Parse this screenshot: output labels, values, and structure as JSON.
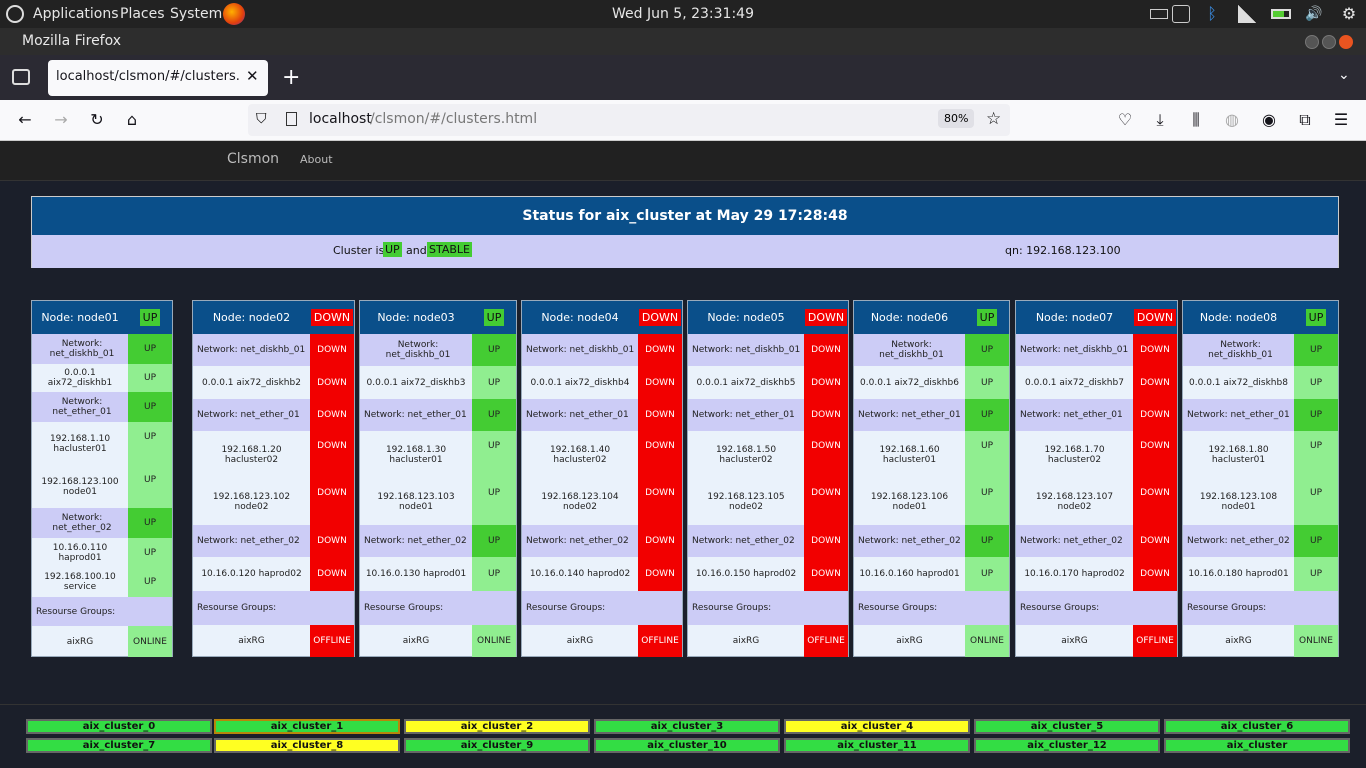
{
  "system_bar": {
    "applications": "Applications",
    "places": "Places",
    "system": "System",
    "clock": "Wed Jun  5, 23:31:49"
  },
  "browser": {
    "window_title": "Mozilla Firefox",
    "tab_title": "localhost/clsmon/#/clusters.html",
    "url_host": "localhost",
    "url_path": "/clsmon/#/clusters.html",
    "zoom": "80%"
  },
  "app": {
    "brand": "Clsmon",
    "about": "About"
  },
  "status": {
    "title": "Status for aix_cluster at May 29 17:28:48",
    "cluster_is": "Cluster is",
    "state": "UP",
    "and": "and",
    "stability": "STABLE",
    "qn": "qn: 192.168.123.100"
  },
  "nodes": [
    {
      "name": "Node: node01",
      "state": "UP",
      "net1": "Network: net_diskhb_01",
      "net1_state": "UP",
      "if1": "0.0.0.1 aix72_diskhb1",
      "if1_state": "UP",
      "net2": "Network: net_ether_01",
      "net2_state": "UP",
      "ip1": "192.168.1.10",
      "ip1_host": "hacluster01",
      "ip1_state": "UP",
      "ip2": "192.168.123.100",
      "ip2_host": "node01",
      "ip2_state": "UP",
      "net3": "Network: net_ether_02",
      "net3_state": "UP",
      "if2": "10.16.0.110 haprod01",
      "if2_state": "UP",
      "if3": "192.168.100.10 service",
      "if3_state": "UP",
      "rg_label": "Resourse Groups:",
      "rg": "aixRG",
      "rg_state": "ONLINE"
    },
    {
      "name": "Node: node02",
      "state": "DOWN",
      "net1": "Network: net_diskhb_01",
      "net1_state": "DOWN",
      "if1": "0.0.0.1 aix72_diskhb2",
      "if1_state": "DOWN",
      "net2": "Network: net_ether_01",
      "net2_state": "DOWN",
      "ip1": "192.168.1.20",
      "ip1_host": "hacluster02",
      "ip1_state": "DOWN",
      "ip2": "192.168.123.102",
      "ip2_host": "node02",
      "ip2_state": "DOWN",
      "net3": "Network: net_ether_02",
      "net3_state": "DOWN",
      "if2": "10.16.0.120 haprod02",
      "if2_state": "DOWN",
      "rg_label": "Resourse Groups:",
      "rg": "aixRG",
      "rg_state": "OFFLINE"
    },
    {
      "name": "Node: node03",
      "state": "UP",
      "net1": "Network: net_diskhb_01",
      "net1_state": "UP",
      "if1": "0.0.0.1 aix72_diskhb3",
      "if1_state": "UP",
      "net2": "Network: net_ether_01",
      "net2_state": "UP",
      "ip1": "192.168.1.30",
      "ip1_host": "hacluster01",
      "ip1_state": "UP",
      "ip2": "192.168.123.103",
      "ip2_host": "node01",
      "ip2_state": "UP",
      "net3": "Network: net_ether_02",
      "net3_state": "UP",
      "if2": "10.16.0.130 haprod01",
      "if2_state": "UP",
      "rg_label": "Resourse Groups:",
      "rg": "aixRG",
      "rg_state": "ONLINE"
    },
    {
      "name": "Node: node04",
      "state": "DOWN",
      "net1": "Network: net_diskhb_01",
      "net1_state": "DOWN",
      "if1": "0.0.0.1 aix72_diskhb4",
      "if1_state": "DOWN",
      "net2": "Network: net_ether_01",
      "net2_state": "DOWN",
      "ip1": "192.168.1.40",
      "ip1_host": "hacluster02",
      "ip1_state": "DOWN",
      "ip2": "192.168.123.104",
      "ip2_host": "node02",
      "ip2_state": "DOWN",
      "net3": "Network: net_ether_02",
      "net3_state": "DOWN",
      "if2": "10.16.0.140 haprod02",
      "if2_state": "DOWN",
      "rg_label": "Resourse Groups:",
      "rg": "aixRG",
      "rg_state": "OFFLINE"
    },
    {
      "name": "Node: node05",
      "state": "DOWN",
      "net1": "Network: net_diskhb_01",
      "net1_state": "DOWN",
      "if1": "0.0.0.1 aix72_diskhb5",
      "if1_state": "DOWN",
      "net2": "Network: net_ether_01",
      "net2_state": "DOWN",
      "ip1": "192.168.1.50",
      "ip1_host": "hacluster02",
      "ip1_state": "DOWN",
      "ip2": "192.168.123.105",
      "ip2_host": "node02",
      "ip2_state": "DOWN",
      "net3": "Network: net_ether_02",
      "net3_state": "DOWN",
      "if2": "10.16.0.150 haprod02",
      "if2_state": "DOWN",
      "rg_label": "Resourse Groups:",
      "rg": "aixRG",
      "rg_state": "OFFLINE"
    },
    {
      "name": "Node: node06",
      "state": "UP",
      "net1": "Network: net_diskhb_01",
      "net1_state": "UP",
      "if1": "0.0.0.1 aix72_diskhb6",
      "if1_state": "UP",
      "net2": "Network: net_ether_01",
      "net2_state": "UP",
      "ip1": "192.168.1.60",
      "ip1_host": "hacluster01",
      "ip1_state": "UP",
      "ip2": "192.168.123.106",
      "ip2_host": "node01",
      "ip2_state": "UP",
      "net3": "Network: net_ether_02",
      "net3_state": "UP",
      "if2": "10.16.0.160 haprod01",
      "if2_state": "UP",
      "rg_label": "Resourse Groups:",
      "rg": "aixRG",
      "rg_state": "ONLINE"
    },
    {
      "name": "Node: node07",
      "state": "DOWN",
      "net1": "Network: net_diskhb_01",
      "net1_state": "DOWN",
      "if1": "0.0.0.1 aix72_diskhb7",
      "if1_state": "DOWN",
      "net2": "Network: net_ether_01",
      "net2_state": "DOWN",
      "ip1": "192.168.1.70",
      "ip1_host": "hacluster02",
      "ip1_state": "DOWN",
      "ip2": "192.168.123.107",
      "ip2_host": "node02",
      "ip2_state": "DOWN",
      "net3": "Network: net_ether_02",
      "net3_state": "DOWN",
      "if2": "10.16.0.170 haprod02",
      "if2_state": "DOWN",
      "rg_label": "Resourse Groups:",
      "rg": "aixRG",
      "rg_state": "OFFLINE"
    },
    {
      "name": "Node: node08",
      "state": "UP",
      "net1": "Network: net_diskhb_01",
      "net1_state": "UP",
      "if1": "0.0.0.1 aix72_diskhb8",
      "if1_state": "UP",
      "net2": "Network: net_ether_01",
      "net2_state": "UP",
      "ip1": "192.168.1.80",
      "ip1_host": "hacluster01",
      "ip1_state": "UP",
      "ip2": "192.168.123.108",
      "ip2_host": "node01",
      "ip2_state": "UP",
      "net3": "Network: net_ether_02",
      "net3_state": "UP",
      "if2": "10.16.0.180 haprod01",
      "if2_state": "UP",
      "rg_label": "Resourse Groups:",
      "rg": "aixRG",
      "rg_state": "ONLINE"
    }
  ],
  "clusters": [
    {
      "name": "aix_cluster_0",
      "color": "green"
    },
    {
      "name": "aix_cluster_1",
      "color": "green"
    },
    {
      "name": "aix_cluster_2",
      "color": "yellow"
    },
    {
      "name": "aix_cluster_3",
      "color": "green"
    },
    {
      "name": "aix_cluster_4",
      "color": "yellow"
    },
    {
      "name": "aix_cluster_5",
      "color": "green"
    },
    {
      "name": "aix_cluster_6",
      "color": "green"
    },
    {
      "name": "aix_cluster_7",
      "color": "green"
    },
    {
      "name": "aix_cluster_8",
      "color": "yellow"
    },
    {
      "name": "aix_cluster_9",
      "color": "green"
    },
    {
      "name": "aix_cluster_10",
      "color": "green"
    },
    {
      "name": "aix_cluster_11",
      "color": "green"
    },
    {
      "name": "aix_cluster_12",
      "color": "green"
    },
    {
      "name": "aix_cluster",
      "color": "green"
    }
  ],
  "colors": {
    "up": "#44cc33",
    "down": "#f20000",
    "header": "#0a4f8a",
    "lavender": "#ccccf6"
  }
}
